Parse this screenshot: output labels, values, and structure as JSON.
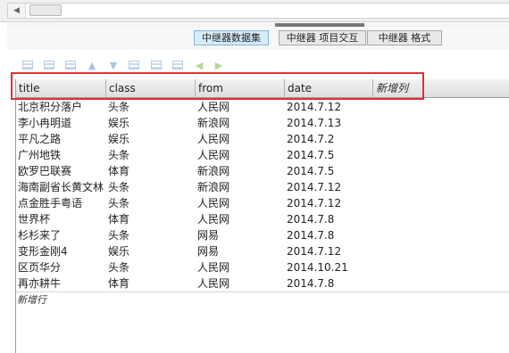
{
  "tabs": [
    {
      "label": "中继器数据集",
      "active": true
    },
    {
      "label": "中继器 项目交互",
      "active": false
    },
    {
      "label": "中继器 格式",
      "active": false
    }
  ],
  "toolbar": {
    "icons": [
      "add-row-above-icon",
      "add-row-below-icon",
      "delete-row-icon",
      "move-up-icon",
      "move-down-icon",
      "add-column-left-icon",
      "add-column-right-icon",
      "delete-column-icon",
      "move-left-icon",
      "move-right-icon"
    ]
  },
  "grid": {
    "columns": [
      "title",
      "class",
      "from",
      "date",
      "新增列"
    ],
    "rows": [
      [
        "北京积分落户",
        "头条",
        "人民网",
        "2014.7.12"
      ],
      [
        "李小冉明道",
        "娱乐",
        "新浪网",
        "2014.7.13"
      ],
      [
        "平凡之路",
        "娱乐",
        "人民网",
        "2014.7.2"
      ],
      [
        "广州地铁",
        "头条",
        "人民网",
        "2014.7.5"
      ],
      [
        "欧罗巴联赛",
        "体育",
        "新浪网",
        "2014.7.5"
      ],
      [
        "海南副省长黄文林",
        "头条",
        "新浪网",
        "2014.7.12"
      ],
      [
        "点金胜手粤语",
        "头条",
        "人民网",
        "2014.7.12"
      ],
      [
        "世界杯",
        "体育",
        "人民网",
        "2014.7.8"
      ],
      [
        "杉杉来了",
        "头条",
        "网易",
        "2014.7.8"
      ],
      [
        "变形金刚4",
        "娱乐",
        "网易",
        "2014.7.12"
      ],
      [
        "区页华分",
        "头条",
        "人民网",
        "2014.10.21"
      ],
      [
        "再亦耕牛",
        "体育",
        "人民网",
        "2014.7.8"
      ]
    ],
    "new_row_label": "新增行"
  }
}
